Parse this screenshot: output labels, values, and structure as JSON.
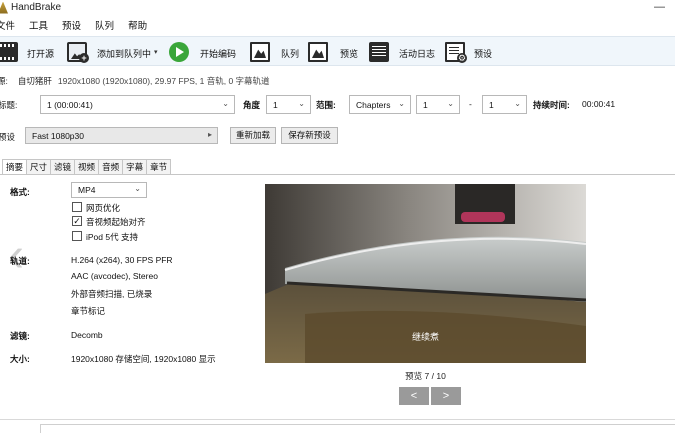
{
  "window": {
    "title": "HandBrake",
    "minimize": "—"
  },
  "menu": [
    "文件",
    "工具",
    "预设",
    "队列",
    "帮助"
  ],
  "toolbar": {
    "open_source": "打开源",
    "add_to_queue": "添加到队列中",
    "start_encode": "开始编码",
    "queue": "队列",
    "preview": "预览",
    "activity_log": "活动日志",
    "presets": "预设",
    "dropdown_caret": "▾"
  },
  "source": {
    "label": "源:",
    "name": "自切猪肝",
    "info": "1920x1080 (1920x1080), 29.97 FPS, 1 音轨, 0 字幕轨道"
  },
  "selection": {
    "title_label": "标题:",
    "title_value": "1 (00:00:41)",
    "angle_label": "角度",
    "angle_value": "1",
    "range_label": "范围:",
    "range_type": "Chapters",
    "range_start": "1",
    "range_dash": "-",
    "range_end": "1",
    "duration_label": "持续时间:",
    "duration_value": "00:00:41"
  },
  "preset": {
    "label": "预设",
    "value": "Fast 1080p30",
    "reload": "重新加载",
    "save_new": "保存新预设",
    "arrow": "▸"
  },
  "tabs": [
    "摘要",
    "尺寸",
    "滤镜",
    "视频",
    "音频",
    "字幕",
    "章节"
  ],
  "summary": {
    "format_label": "格式:",
    "format_value": "MP4",
    "web_optimized": "网页优化",
    "web_optimized_checked": false,
    "align_av": "音视频起始对齐",
    "align_av_checked": true,
    "ipod": "iPod 5代 支持",
    "ipod_checked": false,
    "tracks_label": "轨道:",
    "track_lines": [
      "H.264 (x264), 30 FPS PFR",
      "AAC (avcodec), Stereo",
      "外部音频扫描, 已烧录",
      "章节标记"
    ],
    "filters_label": "滤镜:",
    "filters_value": "Decomb",
    "size_label": "大小:",
    "size_value": "1920x1080 存储空间, 1920x1080 显示"
  },
  "preview": {
    "caption": "继续煮",
    "counter": "预览 7 / 10",
    "prev": "<",
    "next": ">"
  },
  "glyphs": {
    "chevron": "⌄",
    "check": "✓",
    "side_chevron": "‹"
  },
  "colors": {
    "start_green": "#3aa63a",
    "toolbar_bg": "#f0f6fb",
    "nav_button": "#9a9a9a"
  }
}
